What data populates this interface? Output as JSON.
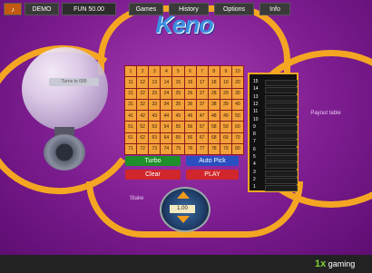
{
  "logo": {
    "text": "Keno"
  },
  "machine": {
    "label": "Turns to 000"
  },
  "board": {
    "numbers": [
      "1",
      "2",
      "3",
      "4",
      "5",
      "6",
      "7",
      "8",
      "9",
      "10",
      "11",
      "12",
      "13",
      "14",
      "15",
      "16",
      "17",
      "18",
      "19",
      "20",
      "21",
      "22",
      "23",
      "24",
      "25",
      "26",
      "27",
      "28",
      "29",
      "30",
      "31",
      "32",
      "33",
      "34",
      "35",
      "36",
      "37",
      "38",
      "39",
      "40",
      "41",
      "42",
      "43",
      "44",
      "45",
      "46",
      "47",
      "48",
      "49",
      "50",
      "51",
      "52",
      "53",
      "54",
      "55",
      "56",
      "57",
      "58",
      "59",
      "60",
      "61",
      "62",
      "63",
      "64",
      "65",
      "66",
      "67",
      "68",
      "69",
      "70",
      "71",
      "72",
      "73",
      "74",
      "75",
      "76",
      "77",
      "78",
      "79",
      "80"
    ]
  },
  "buttons": {
    "turbo": "Turbo",
    "auto_pick": "Auto Pick",
    "clear": "Clear",
    "play": "PLAY"
  },
  "stake": {
    "label": "Stake",
    "value": "1.00"
  },
  "payout": {
    "title": "Payout table",
    "rows": [
      "15",
      "14",
      "13",
      "12",
      "11",
      "10",
      "9",
      "8",
      "7",
      "6",
      "5",
      "4",
      "3",
      "2",
      "1"
    ]
  },
  "bottom_bar": {
    "demo": "DEMO",
    "balance": "FUN 50.00",
    "games": "Games",
    "history": "History",
    "options": "Options",
    "info": "Info",
    "brand": "gaming",
    "brand_mark": "1x"
  },
  "colors": {
    "accent": "#f4a623",
    "background": "#7d1d90",
    "turbo": "#1e8f2a",
    "auto_pick": "#2a4fc0",
    "play": "#d0262c"
  },
  "icons": {
    "sound": "speaker-icon"
  }
}
